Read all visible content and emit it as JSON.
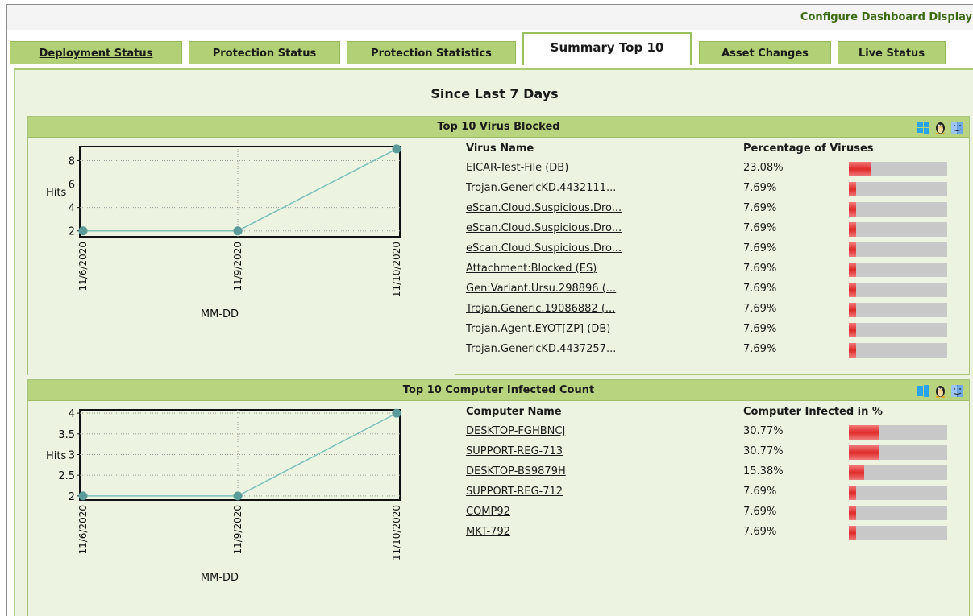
{
  "header": {
    "configure_label": "Configure Dashboard Display"
  },
  "tabs": [
    {
      "label": "Deployment Status",
      "active": false
    },
    {
      "label": "Protection Status",
      "active": false
    },
    {
      "label": "Protection Statistics",
      "active": false
    },
    {
      "label": "Summary Top 10",
      "active": true
    },
    {
      "label": "Asset Changes",
      "active": false
    },
    {
      "label": "Live Status",
      "active": false
    }
  ],
  "period_title": "Since Last 7 Days",
  "colors": {
    "tab_bg": "#b2d075",
    "panel_header": "#b8d47e",
    "content_bg": "#ecf3e0",
    "line": "#7cc0bc",
    "point": "#5b9c9a",
    "bar_fill": "#e02a2a",
    "bar_track": "#c8c8c8"
  },
  "icons": [
    "windows-icon",
    "linux-icon",
    "mac-icon"
  ],
  "virus_panel": {
    "title": "Top 10 Virus Blocked",
    "col_name": "Virus Name",
    "col_pct": "Percentage of Viruses",
    "rows": [
      {
        "name": "EICAR-Test-File (DB)",
        "pct": "23.08%",
        "value": 23.08
      },
      {
        "name": "Trojan.GenericKD.4432111...",
        "pct": "7.69%",
        "value": 7.69
      },
      {
        "name": "eScan.Cloud.Suspicious.Dro...",
        "pct": "7.69%",
        "value": 7.69
      },
      {
        "name": "eScan.Cloud.Suspicious.Dro...",
        "pct": "7.69%",
        "value": 7.69
      },
      {
        "name": "eScan.Cloud.Suspicious.Dro...",
        "pct": "7.69%",
        "value": 7.69
      },
      {
        "name": "Attachment:Blocked (ES)",
        "pct": "7.69%",
        "value": 7.69
      },
      {
        "name": "Gen:Variant.Ursu.298896 (...",
        "pct": "7.69%",
        "value": 7.69
      },
      {
        "name": "Trojan.Generic.19086882 (...",
        "pct": "7.69%",
        "value": 7.69
      },
      {
        "name": "Trojan.Agent.EYOT[ZP] (DB)",
        "pct": "7.69%",
        "value": 7.69
      },
      {
        "name": "Trojan.GenericKD.4437257...",
        "pct": "7.69%",
        "value": 7.69
      }
    ]
  },
  "computer_panel": {
    "title": "Top 10 Computer Infected Count",
    "col_name": "Computer Name",
    "col_pct": "Computer Infected in %",
    "rows": [
      {
        "name": "DESKTOP-FGHBNCJ",
        "pct": "30.77%",
        "value": 30.77
      },
      {
        "name": "SUPPORT-REG-713",
        "pct": "30.77%",
        "value": 30.77
      },
      {
        "name": "DESKTOP-BS9879H",
        "pct": "15.38%",
        "value": 15.38
      },
      {
        "name": "SUPPORT-REG-712",
        "pct": "7.69%",
        "value": 7.69
      },
      {
        "name": "COMP92",
        "pct": "7.69%",
        "value": 7.69
      },
      {
        "name": "MKT-792",
        "pct": "7.69%",
        "value": 7.69
      }
    ]
  },
  "chart_data": [
    {
      "type": "line",
      "x": [
        "11/6/2020",
        "11/9/2020",
        "11/10/2020"
      ],
      "series": [
        {
          "values": [
            2,
            2,
            9
          ]
        }
      ],
      "xlabel": "MM-DD",
      "ylabel": "Hits",
      "yticks": [
        "2",
        "4",
        "6",
        "8"
      ],
      "ylim": [
        1.5,
        9.2
      ],
      "grid": true
    },
    {
      "type": "line",
      "x": [
        "11/6/2020",
        "11/9/2020",
        "11/10/2020"
      ],
      "series": [
        {
          "values": [
            2,
            2,
            4
          ]
        }
      ],
      "xlabel": "MM-DD",
      "ylabel": "Hits",
      "yticks": [
        "2",
        "2.5",
        "3",
        "3.5",
        "4"
      ],
      "ylim": [
        1.9,
        4.08
      ],
      "grid": true
    }
  ]
}
